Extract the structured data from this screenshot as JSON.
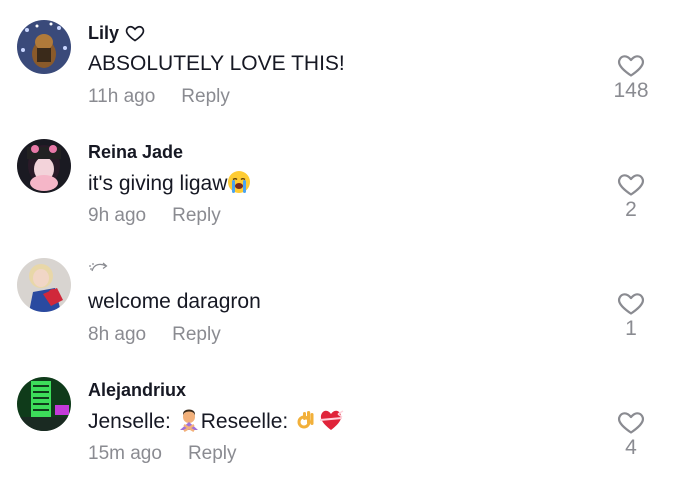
{
  "comments": [
    {
      "username": "Lily",
      "has_heart_badge": true,
      "text": "ABSOLUTELY LOVE THIS!",
      "time": "11h ago",
      "reply_label": "Reply",
      "like_count": "148",
      "avatar_bg": "#3a4a7a"
    },
    {
      "username": "Reina Jade",
      "text": "it's giving ligaw",
      "text_emoji": "loudly-crying-face-icon",
      "time": "9h ago",
      "reply_label": "Reply",
      "like_count": "2",
      "avatar_bg": "#1a1a22"
    },
    {
      "username": "",
      "username_glyph": "sparkle-arrow-icon",
      "text": "welcome daragron",
      "time": "8h ago",
      "reply_label": "Reply",
      "like_count": "1",
      "avatar_bg": "#d8d4d0"
    },
    {
      "username": "Alejandriux",
      "text_part1": "Jenselle: ",
      "text_emoji1": "person-gesturing-no-icon",
      "text_part2": "Reseelle: ",
      "text_emoji2": "ok-hand-icon",
      "text_emoji3": "heart-with-ribbon-icon",
      "time": "15m ago",
      "reply_label": "Reply",
      "like_count": "4",
      "avatar_bg": "#0f3b1a"
    }
  ],
  "colors": {
    "text_primary": "#161823",
    "text_secondary": "#8a8b91",
    "icon_outline": "#8a8b91"
  }
}
